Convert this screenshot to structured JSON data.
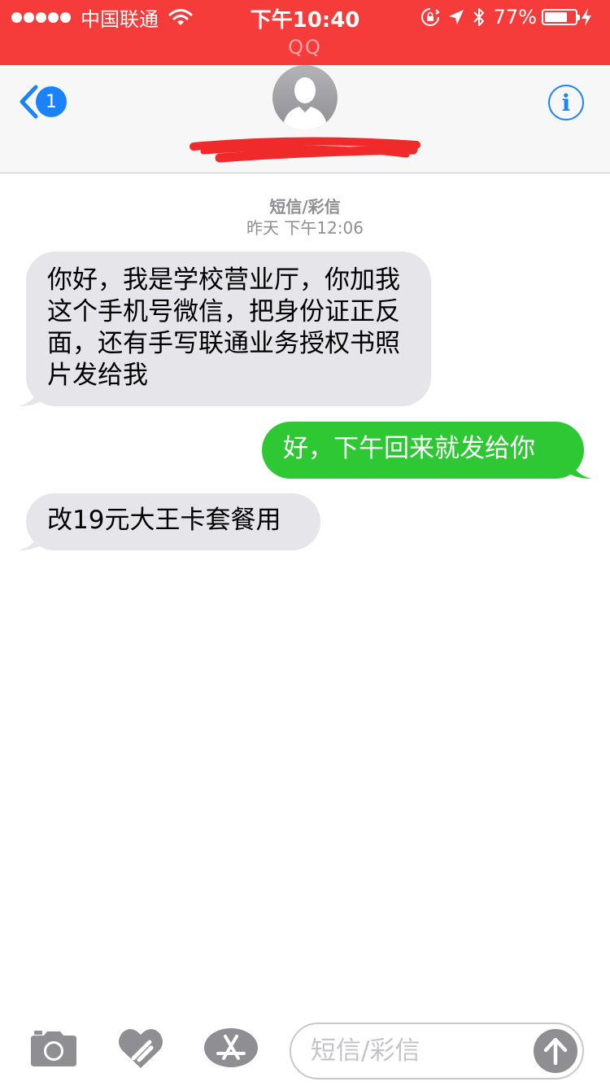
{
  "status_bar": {
    "carrier": "中国联通",
    "time": "下午10:40",
    "battery": "77%",
    "battery_level": 0.77
  },
  "return_app": "QQ",
  "header": {
    "back_badge": "1",
    "info_icon": "info-icon",
    "contact_icon": "person-silhouette-icon"
  },
  "conversation": {
    "message_type": "短信/彩信",
    "timestamp": "昨天 下午12:06",
    "messages": [
      {
        "direction": "incoming",
        "text": "你好，我是学校营业厅，你加我这个手机号微信，把身份证正反面，还有手写联通业务授权书照片发给我"
      },
      {
        "direction": "outgoing",
        "text": "好，下午回来就发给你"
      },
      {
        "direction": "incoming",
        "text": "改19元大王卡套餐用"
      }
    ]
  },
  "input_bar": {
    "placeholder": "短信/彩信",
    "tools": [
      "camera-icon",
      "digital-touch-heart-icon",
      "app-store-icon"
    ],
    "send_icon": "arrow-up-icon"
  },
  "colors": {
    "status_bar": "#f63b3b",
    "ios_blue": "#1a82fb",
    "incoming_bubble": "#e5e5ea",
    "outgoing_bubble": "#2dc834",
    "redaction": "#f02a2a"
  }
}
